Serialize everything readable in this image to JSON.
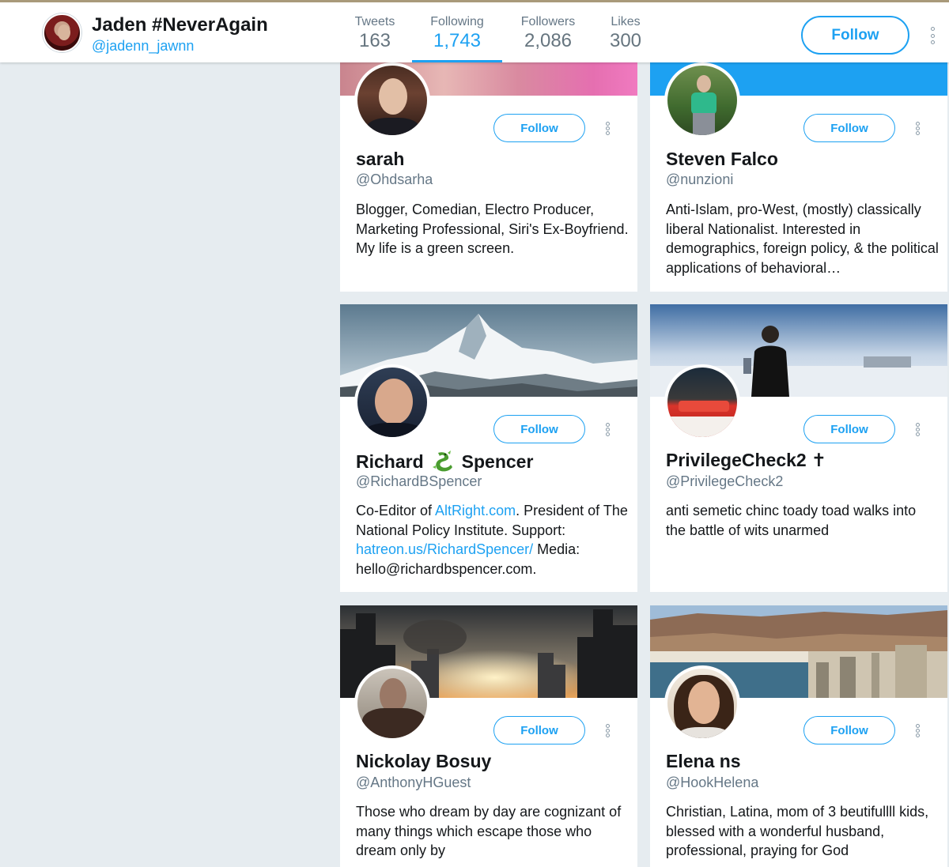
{
  "profile": {
    "name": "Jaden #NeverAgain",
    "handle": "@jadenn_jawnn",
    "follow_label": "Follow"
  },
  "stats": [
    {
      "label": "Tweets",
      "value": "163"
    },
    {
      "label": "Following",
      "value": "1,743",
      "active": true
    },
    {
      "label": "Followers",
      "value": "2,086"
    },
    {
      "label": "Likes",
      "value": "300"
    }
  ],
  "colors": {
    "accent": "#1da1f2",
    "background": "#e6ecf0",
    "text": "#14171a",
    "muted": "#657786"
  },
  "icons": {
    "more": "more-vertical-icon",
    "dragon": "dragon-emoji",
    "cross": "latin-cross"
  },
  "cards": [
    {
      "name": "sarah",
      "handle": "@Ohdsarha",
      "follow_label": "Follow",
      "bio": "Blogger, Comedian, Electro Producer, Marketing Professional, Siri's Ex-Boyfriend. My life is a green screen."
    },
    {
      "name": "Steven Falco",
      "handle": "@nunzioni",
      "follow_label": "Follow",
      "bio": "Anti-Islam, pro-West, (mostly) classically liberal Nationalist. Interested in demographics, foreign policy, & the political applications of behavioral…"
    },
    {
      "name_first": "Richard",
      "name_last": "Spencer",
      "handle": "@RichardBSpencer",
      "follow_label": "Follow",
      "bio_parts": {
        "p1": "Co-Editor of ",
        "link1": "AltRight.com",
        "p2": ". President of The National Policy Institute. Support: ",
        "link2": "hatreon.us/RichardSpencer/",
        "p3": " Media: hello@richardbspencer.com."
      }
    },
    {
      "name": "PrivilegeCheck2",
      "name_symbol": "✝",
      "handle": "@PrivilegeCheck2",
      "follow_label": "Follow",
      "bio": "anti semetic chinc toady toad walks into the battle of wits unarmed"
    },
    {
      "name": "Nickolay Bosuy",
      "handle": "@AnthonyHGuest",
      "follow_label": "Follow",
      "bio": "Those who dream by day are cognizant of many things which escape those who dream only by"
    },
    {
      "name": "Elena ns",
      "handle": "@HookHelena",
      "follow_label": "Follow",
      "bio": "Christian, Latina, mom of 3 beutifullll kids, blessed with a wonderful husband, professional, praying for God"
    }
  ]
}
